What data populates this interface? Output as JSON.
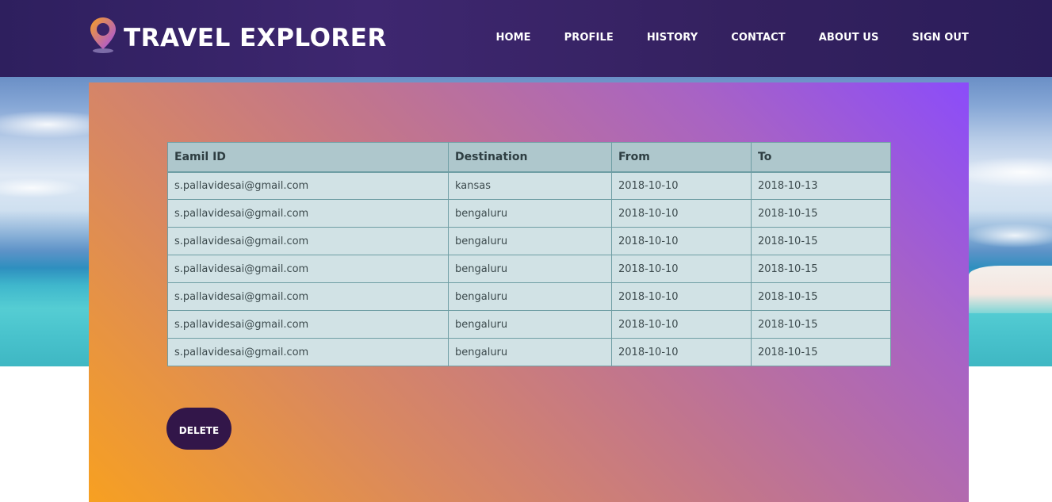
{
  "brand": {
    "title": "TRAVEL EXPLORER"
  },
  "nav": {
    "items": [
      {
        "label": "HOME"
      },
      {
        "label": "PROFILE"
      },
      {
        "label": "HISTORY"
      },
      {
        "label": "CONTACT"
      },
      {
        "label": "ABOUT US"
      },
      {
        "label": "SIGN OUT"
      }
    ]
  },
  "table": {
    "headers": [
      "Eamil ID",
      "Destination",
      "From",
      "To"
    ],
    "rows": [
      [
        "s.pallavidesai@gmail.com",
        "kansas",
        "2018-10-10",
        "2018-10-13"
      ],
      [
        "s.pallavidesai@gmail.com",
        "bengaluru",
        "2018-10-10",
        "2018-10-15"
      ],
      [
        "s.pallavidesai@gmail.com",
        "bengaluru",
        "2018-10-10",
        "2018-10-15"
      ],
      [
        "s.pallavidesai@gmail.com",
        "bengaluru",
        "2018-10-10",
        "2018-10-15"
      ],
      [
        "s.pallavidesai@gmail.com",
        "bengaluru",
        "2018-10-10",
        "2018-10-15"
      ],
      [
        "s.pallavidesai@gmail.com",
        "bengaluru",
        "2018-10-10",
        "2018-10-15"
      ],
      [
        "s.pallavidesai@gmail.com",
        "bengaluru",
        "2018-10-10",
        "2018-10-15"
      ]
    ]
  },
  "actions": {
    "delete_label": "DELETE"
  },
  "icons": {
    "logo": "map-pin-icon"
  },
  "colors": {
    "header": "#34215f",
    "button": "#321649",
    "panel_start": "#f7a021",
    "panel_end": "#8b4cfa",
    "table_bg": "#d1e2e5",
    "table_header": "#aec7cc"
  }
}
